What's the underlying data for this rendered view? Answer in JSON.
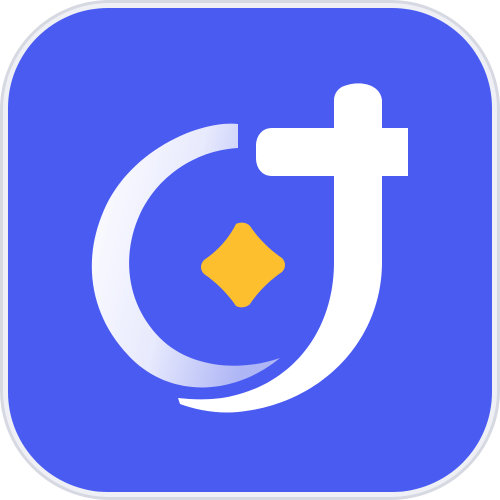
{
  "app_icon": {
    "icon_name": "app-logo-icon",
    "colors": {
      "background": "#4A5BF2",
      "border": "#D6D8E2",
      "glyph": "#FFFFFF",
      "glyph_fade": "#C9CDF8",
      "sparkle": "#FDBF2D"
    }
  }
}
